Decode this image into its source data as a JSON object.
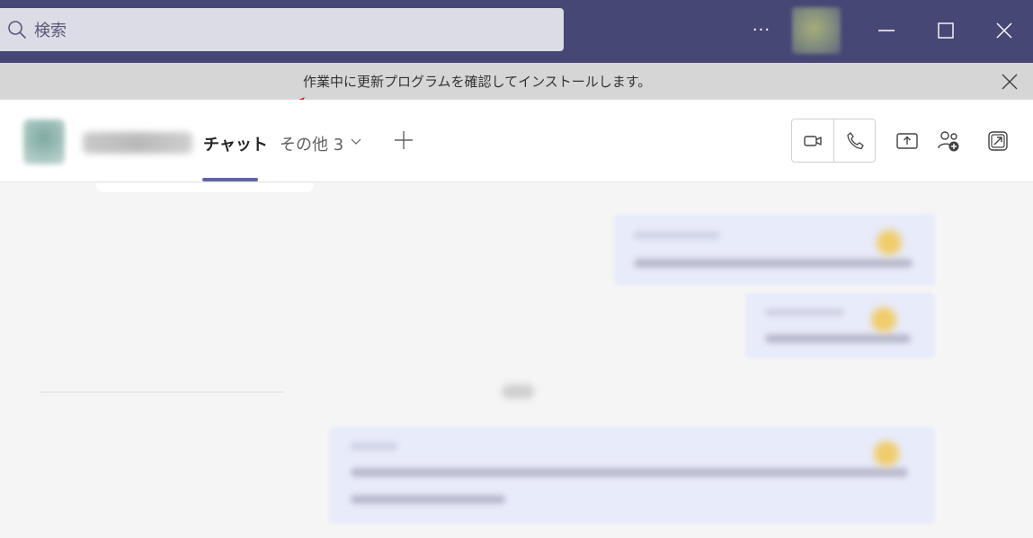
{
  "titlebar": {
    "search_placeholder": "検索",
    "more_label": "···",
    "accent_color": "#464775"
  },
  "notification": {
    "message": "作業中に更新プログラムを確認してインストールします。"
  },
  "header": {
    "tabs": [
      {
        "label": "チャット",
        "active": true
      },
      {
        "label": "その他 3"
      }
    ],
    "accent_color": "#6264a7"
  },
  "icons": {
    "search": "search-icon",
    "minimize": "minimize-icon",
    "maximize": "maximize-icon",
    "close": "close-icon",
    "video": "video-call-icon",
    "phone": "audio-call-icon",
    "share": "screen-share-icon",
    "people": "add-people-icon",
    "popout": "popout-icon",
    "add_tab": "plus-icon"
  }
}
